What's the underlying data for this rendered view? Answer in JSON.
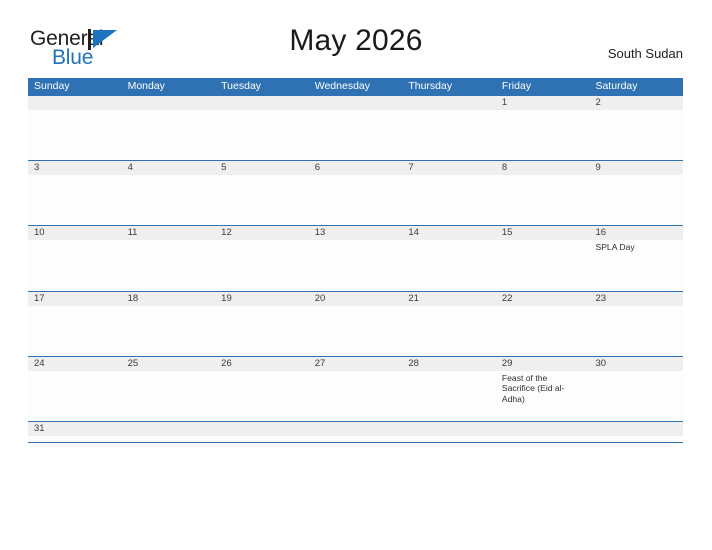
{
  "brand": {
    "name_part1": "General",
    "name_part2": "Blue",
    "mark": "flag-triangle-logo",
    "accent_color": "#1e73be"
  },
  "header": {
    "title": "May 2026",
    "locale": "South Sudan"
  },
  "calendar": {
    "header_color": "#2e72b3",
    "daynum_band_color": "#efefef",
    "weekday_labels": [
      "Sunday",
      "Monday",
      "Tuesday",
      "Wednesday",
      "Thursday",
      "Friday",
      "Saturday"
    ],
    "weeks": [
      {
        "days": [
          {
            "num": "",
            "events": []
          },
          {
            "num": "",
            "events": []
          },
          {
            "num": "",
            "events": []
          },
          {
            "num": "",
            "events": []
          },
          {
            "num": "",
            "events": []
          },
          {
            "num": "1",
            "events": []
          },
          {
            "num": "2",
            "events": []
          }
        ]
      },
      {
        "days": [
          {
            "num": "3",
            "events": []
          },
          {
            "num": "4",
            "events": []
          },
          {
            "num": "5",
            "events": []
          },
          {
            "num": "6",
            "events": []
          },
          {
            "num": "7",
            "events": []
          },
          {
            "num": "8",
            "events": []
          },
          {
            "num": "9",
            "events": []
          }
        ]
      },
      {
        "days": [
          {
            "num": "10",
            "events": []
          },
          {
            "num": "11",
            "events": []
          },
          {
            "num": "12",
            "events": []
          },
          {
            "num": "13",
            "events": []
          },
          {
            "num": "14",
            "events": []
          },
          {
            "num": "15",
            "events": []
          },
          {
            "num": "16",
            "events": [
              "SPLA Day"
            ]
          }
        ]
      },
      {
        "days": [
          {
            "num": "17",
            "events": []
          },
          {
            "num": "18",
            "events": []
          },
          {
            "num": "19",
            "events": []
          },
          {
            "num": "20",
            "events": []
          },
          {
            "num": "21",
            "events": []
          },
          {
            "num": "22",
            "events": []
          },
          {
            "num": "23",
            "events": []
          }
        ]
      },
      {
        "days": [
          {
            "num": "24",
            "events": []
          },
          {
            "num": "25",
            "events": []
          },
          {
            "num": "26",
            "events": []
          },
          {
            "num": "27",
            "events": []
          },
          {
            "num": "28",
            "events": []
          },
          {
            "num": "29",
            "events": [
              "Feast of the Sacrifice (Eid al-Adha)"
            ]
          },
          {
            "num": "30",
            "events": []
          }
        ]
      },
      {
        "last": true,
        "days": [
          {
            "num": "31",
            "events": []
          },
          {
            "num": "",
            "events": []
          },
          {
            "num": "",
            "events": []
          },
          {
            "num": "",
            "events": []
          },
          {
            "num": "",
            "events": []
          },
          {
            "num": "",
            "events": []
          },
          {
            "num": "",
            "events": []
          }
        ]
      }
    ]
  }
}
